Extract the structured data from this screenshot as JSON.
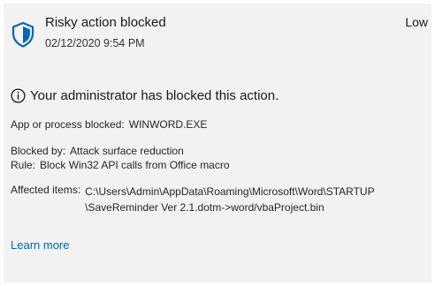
{
  "notification": {
    "title": "Risky action blocked",
    "timestamp": "02/12/2020 9:54 PM",
    "severity": "Low",
    "message": "Your administrator has blocked this action.",
    "app_label": "App or process blocked:",
    "app_value": "WINWORD.EXE",
    "blocked_by_label": "Blocked by:",
    "blocked_by_value": "Attack surface reduction",
    "rule_label": "Rule:",
    "rule_value": "Block Win32 API calls from Office macro",
    "affected_label": "Affected items:",
    "affected_lines": [
      "C:\\Users\\Admin\\AppData\\Roaming\\Microsoft\\Word\\STARTUP",
      "\\SaveReminder Ver 2.1.dotm->word/vbaProject.bin"
    ],
    "learn_more": "Learn more"
  },
  "icons": {
    "header": "shield-icon",
    "message": "info-icon"
  },
  "colors": {
    "background": "#f2f2f2",
    "shield": "#0067b8",
    "link": "#0067b8"
  }
}
